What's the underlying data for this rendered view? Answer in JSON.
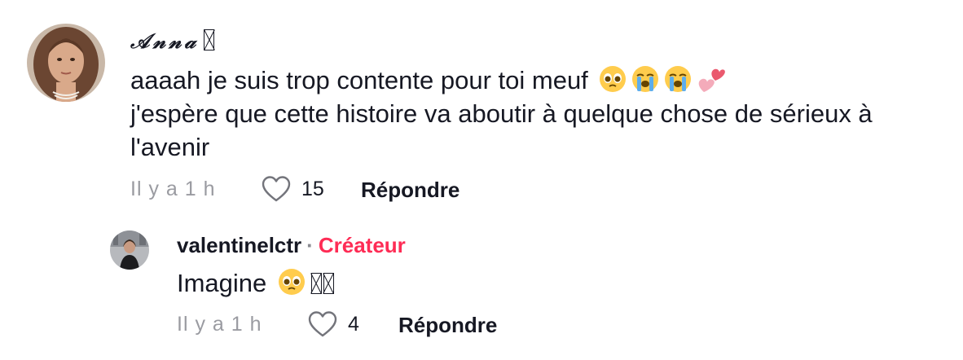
{
  "comments": [
    {
      "username": "𝒜𝓃𝓃𝒶",
      "text_line_1": "aaaah je suis trop contente pour toi meuf",
      "text_line_2": "j'espère que cette histoire va aboutir à quelque chose de sérieux à",
      "text_line_3": "l'avenir",
      "emojis": [
        "pleading-face",
        "loudly-crying-face",
        "loudly-crying-face",
        "two-hearts"
      ],
      "time": "Il y a 1 h",
      "likes": "15",
      "reply_label": "Répondre"
    }
  ],
  "reply": {
    "username": "valentinelctr",
    "separator": "·",
    "badge": "Créateur",
    "text": "Imagine",
    "emojis": [
      "pleading-face"
    ],
    "time": "Il y a 1 h",
    "likes": "4",
    "reply_label": "Répondre"
  },
  "colors": {
    "text": "#161823",
    "muted": "#9a9ba1",
    "creator_badge": "#fe2c55"
  },
  "icons": [
    "heart-outline-icon"
  ]
}
